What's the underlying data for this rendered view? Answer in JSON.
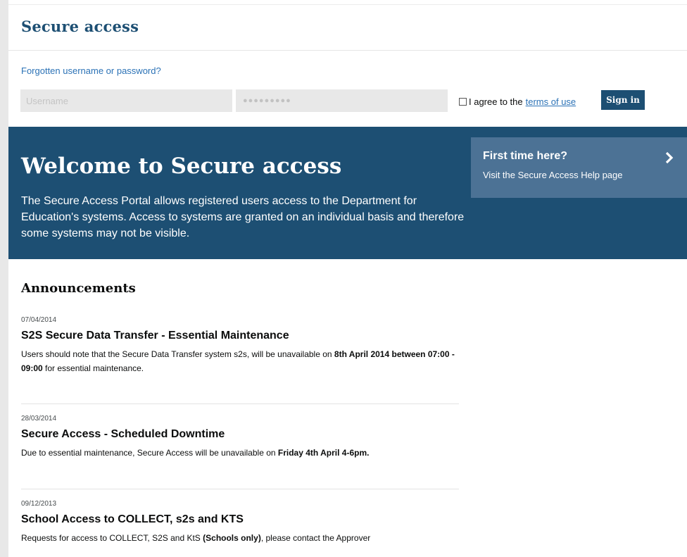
{
  "header": {
    "title": "Secure access"
  },
  "login": {
    "forgot_link": "Forgotten username or password?",
    "username_placeholder": "Username",
    "password_mask": "●●●●●●●●●",
    "agree_prefix": "I agree to the",
    "agree_link": "terms of use",
    "signin_label": "Sign in"
  },
  "hero": {
    "title": "Welcome to Secure access",
    "text": "The Secure Access Portal allows registered users access to the Department for Education's systems. Access to systems are granted on an individual basis and therefore some systems may not be visible.",
    "first_time": {
      "title": "First time here?",
      "text": "Visit the Secure Access Help page",
      "icon": "chevron-right-icon"
    }
  },
  "announcements": {
    "heading": "Announcements",
    "items": [
      {
        "date": "07/04/2014",
        "title": "S2S Secure Data Transfer - Essential Maintenance",
        "body_a": "Users should note that the Secure Data Transfer system s2s, will be unavailable on",
        "body_bold": "8th April 2014 between 07:00 - 09:00",
        "body_b": "for essential maintenance."
      },
      {
        "date": "28/03/2014",
        "title": "Secure Access - Scheduled Downtime",
        "body_a": "Due to essential maintenance, Secure Access will be unavailable on",
        "body_bold": "Friday 4th April 4-6pm.",
        "body_b": ""
      },
      {
        "date": "09/12/2013",
        "title": "School Access to COLLECT, s2s and KTS",
        "body_a": "Requests for access to COLLECT, S2S and KtS",
        "body_bold": "(Schools only)",
        "body_b": ", please contact the Approver"
      }
    ]
  },
  "colors": {
    "brand": "#1d4f73",
    "link": "#2b72b6",
    "panel": "#4c7295"
  }
}
